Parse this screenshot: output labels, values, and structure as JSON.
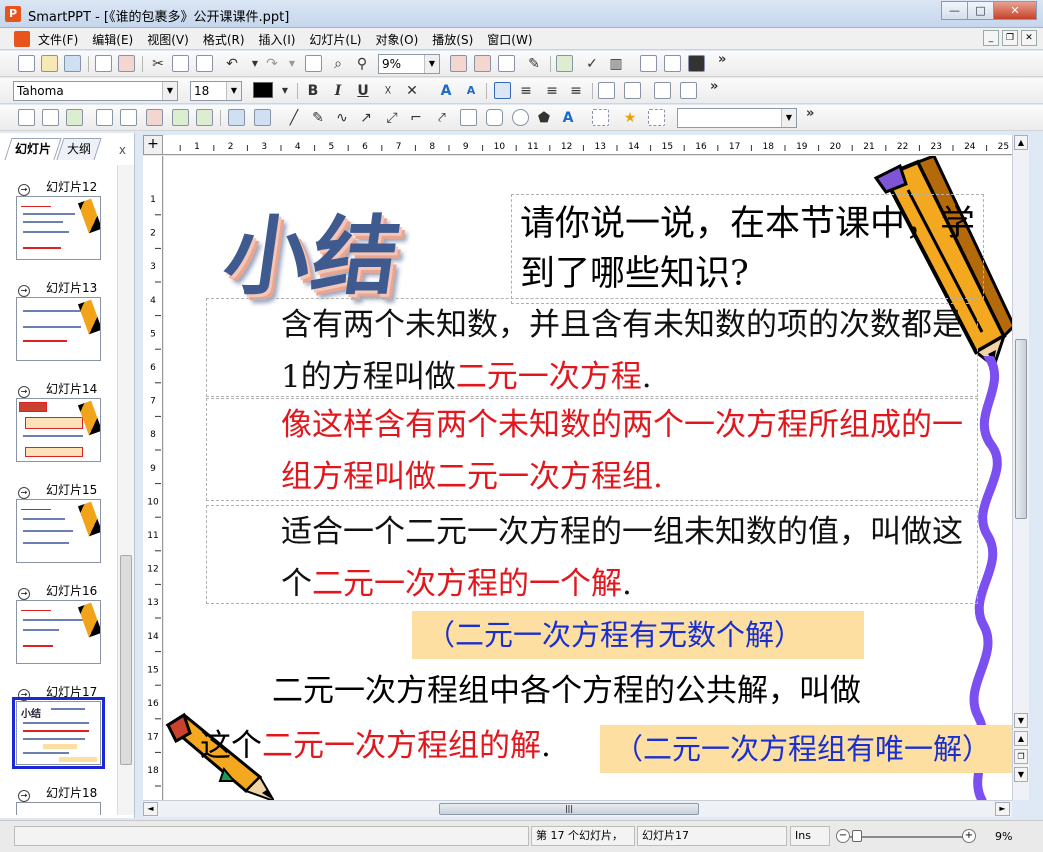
{
  "window": {
    "app_icon": "P",
    "title": "SmartPPT - [《谁的包裹多》公开课课件.ppt]",
    "buttons": {
      "minimize": "—",
      "maximize": "□",
      "close": "✕"
    }
  },
  "menu": {
    "items": [
      "文件(F)",
      "编辑(E)",
      "视图(V)",
      "格式(R)",
      "插入(I)",
      "幻灯片(L)",
      "对象(O)",
      "播放(S)",
      "窗口(W)"
    ],
    "mdi": {
      "minimize": "_",
      "restore": "❐",
      "close": "✕"
    }
  },
  "toolbar1": {
    "zoom_value": "9%",
    "more": "»"
  },
  "toolbar2": {
    "font_name": "Tahoma",
    "font_size": "18",
    "bold": "B",
    "italic": "I",
    "underline": "U",
    "more": "»"
  },
  "toolbar3": {
    "more": "»"
  },
  "panel": {
    "tabs": [
      "幻灯片",
      "大纲"
    ],
    "close": "x",
    "slides": [
      {
        "label": "幻灯片12"
      },
      {
        "label": "幻灯片13"
      },
      {
        "label": "幻灯片14"
      },
      {
        "label": "幻灯片15"
      },
      {
        "label": "幻灯片16"
      },
      {
        "label": "幻灯片17",
        "thumb_title": "小结"
      },
      {
        "label": "幻灯片18"
      }
    ]
  },
  "ruler": {
    "h_ticks": [
      "1",
      "2",
      "3",
      "4",
      "5",
      "6",
      "7",
      "8",
      "9",
      "10",
      "11",
      "12",
      "13",
      "14",
      "15",
      "16",
      "17",
      "18",
      "19",
      "20",
      "21",
      "22",
      "23",
      "24",
      "25"
    ],
    "v_ticks": [
      "1",
      "2",
      "3",
      "4",
      "5",
      "6",
      "7",
      "8",
      "9",
      "10",
      "11",
      "12",
      "13",
      "14",
      "15",
      "16",
      "17",
      "18"
    ],
    "corner": "+"
  },
  "slide": {
    "wordart_title": "小结",
    "question": "请你说一说，在本节课中，学到了哪些知识?",
    "def1": {
      "pre": "含有两个未知数，并且含有未知数的项的次数都是1的方程叫做",
      "term": "二元一次方程",
      "post": "."
    },
    "def2": {
      "text": "像这样含有两个未知数的两个一次方程所组成的一组方程叫做二元一次方程组."
    },
    "def3": {
      "pre": "适合一个二元一次方程的一组未知数的值，叫做这个",
      "term": "二元一次方程的一个解",
      "post": "."
    },
    "callout1": "（二元一次方程有无数个解）",
    "def4": {
      "line1": "二元一次方程组中各个方程的公共解，叫做",
      "pre": "这个",
      "term": "二元一次方程组的解",
      "post": "."
    },
    "callout2": "（二元一次方程组有唯一解）"
  },
  "status": {
    "slide_of": "第 17 个幻灯片，",
    "slide_name": "幻灯片17",
    "mode": "Ins",
    "zoom": "9%",
    "zoom_fraction": 0.05,
    "minus": "−",
    "plus": "+"
  },
  "scroll": {
    "up": "▲",
    "down": "▼",
    "left": "◄",
    "right": "►",
    "grip": "|||",
    "prev_slide": "▲",
    "next_slide": "▼"
  },
  "colors": {
    "red_text": "#e2171d",
    "blue_text": "#1a2fd1",
    "callout_bg": "#fde0a1",
    "selection": "#1927d8"
  }
}
